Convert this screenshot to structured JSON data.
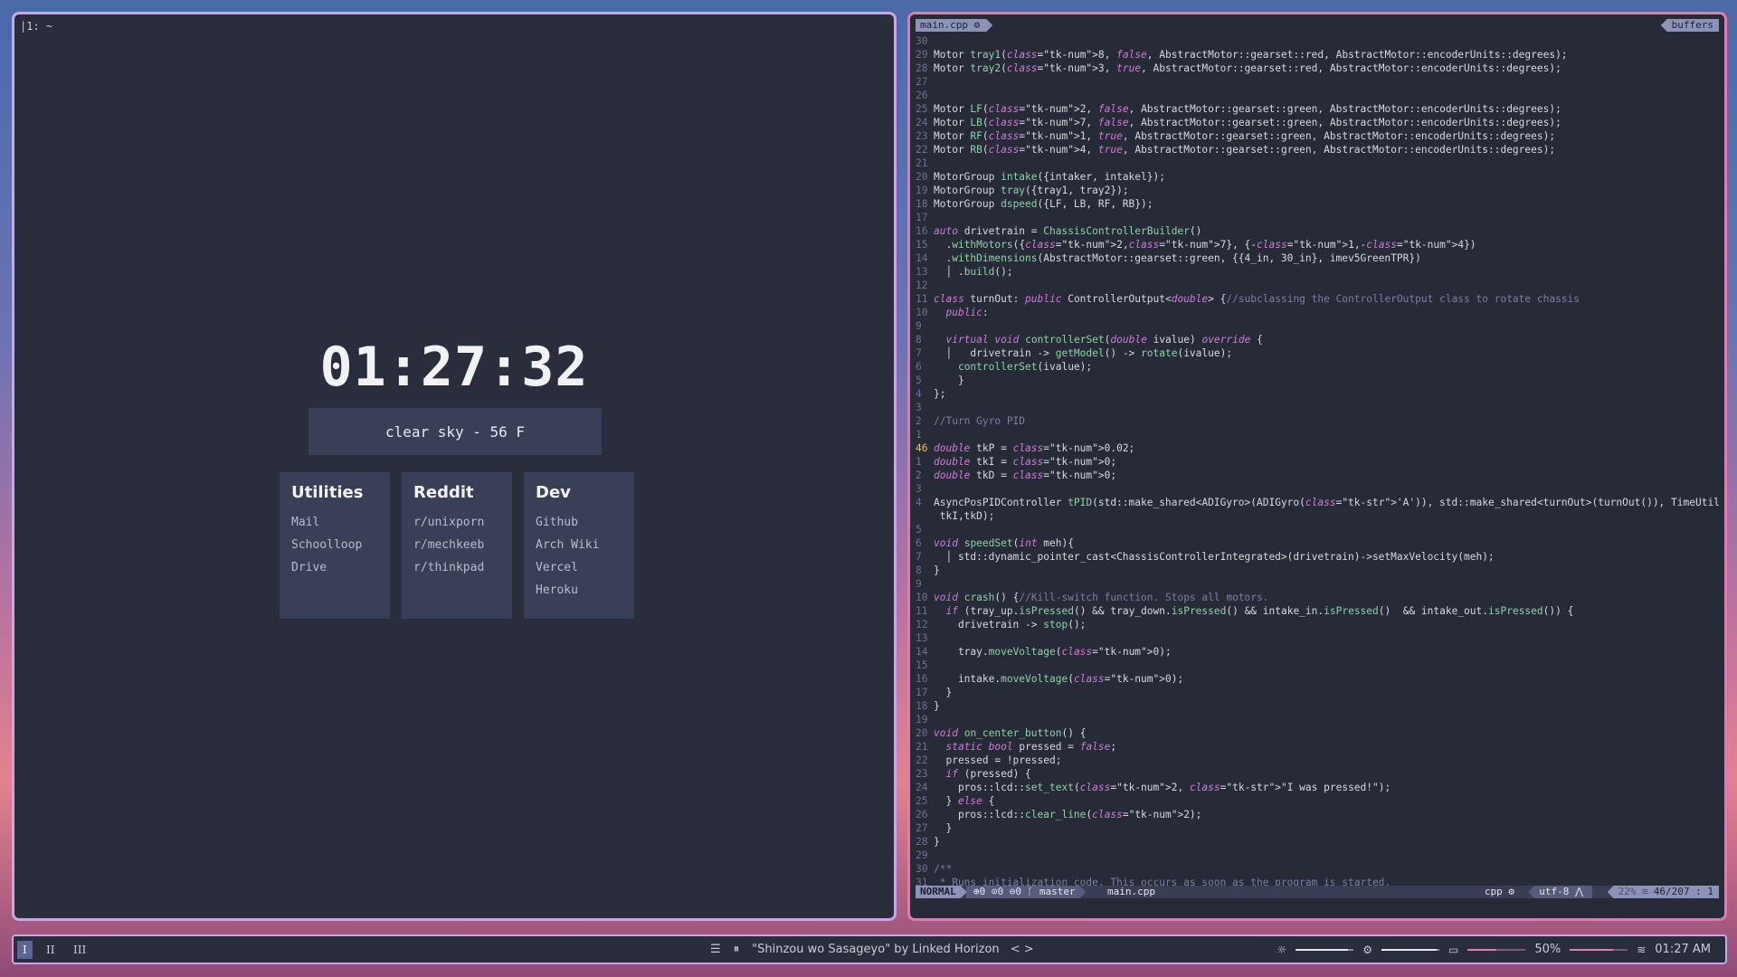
{
  "terminal": {
    "prompt": "|1: ~"
  },
  "startpage": {
    "clock": "01:27:32",
    "weather": "clear sky - 56 F",
    "cards": [
      {
        "title": "Utilities",
        "links": [
          "Mail",
          "Schoolloop",
          "Drive"
        ]
      },
      {
        "title": "Reddit",
        "links": [
          "r/unixporn",
          "r/mechkeeb",
          "r/thinkpad"
        ]
      },
      {
        "title": "Dev",
        "links": [
          "Github",
          "Arch Wiki",
          "Vercel",
          "Heroku"
        ]
      }
    ]
  },
  "editor": {
    "tab_file": "main.cpp ⚙",
    "tab_buffers": "buffers",
    "lines": [
      {
        "n": "30",
        "t": ""
      },
      {
        "n": "29",
        "t": "Motor tray1(8, false, AbstractMotor::gearset::red, AbstractMotor::encoderUnits::degrees);"
      },
      {
        "n": "28",
        "t": "Motor tray2(3, true, AbstractMotor::gearset::red, AbstractMotor::encoderUnits::degrees);"
      },
      {
        "n": "27",
        "t": ""
      },
      {
        "n": "26",
        "t": ""
      },
      {
        "n": "25",
        "t": "Motor LF(2, false, AbstractMotor::gearset::green, AbstractMotor::encoderUnits::degrees);"
      },
      {
        "n": "24",
        "t": "Motor LB(7, false, AbstractMotor::gearset::green, AbstractMotor::encoderUnits::degrees);"
      },
      {
        "n": "23",
        "t": "Motor RF(1, true, AbstractMotor::gearset::green, AbstractMotor::encoderUnits::degrees);"
      },
      {
        "n": "22",
        "t": "Motor RB(4, true, AbstractMotor::gearset::green, AbstractMotor::encoderUnits::degrees);"
      },
      {
        "n": "21",
        "t": ""
      },
      {
        "n": "20",
        "t": "MotorGroup intake({intaker, intakel});"
      },
      {
        "n": "19",
        "t": "MotorGroup tray({tray1, tray2});"
      },
      {
        "n": "18",
        "t": "MotorGroup dspeed({LF, LB, RF, RB});"
      },
      {
        "n": "17",
        "t": ""
      },
      {
        "n": "16",
        "t": "auto drivetrain = ChassisControllerBuilder()"
      },
      {
        "n": "15",
        "t": "  .withMotors({2,7}, {-1,-4})"
      },
      {
        "n": "14",
        "t": "  .withDimensions(AbstractMotor::gearset::green, {{4_in, 30_in}, imev5GreenTPR})"
      },
      {
        "n": "13",
        "t": "  │ .build();"
      },
      {
        "n": "12",
        "t": ""
      },
      {
        "n": "11",
        "t": "class turnOut: public ControllerOutput<double> {//subclassing the ControllerOutput class to rotate chassis"
      },
      {
        "n": "10",
        "t": "  public:"
      },
      {
        "n": "9",
        "t": ""
      },
      {
        "n": "8",
        "t": "  virtual void controllerSet(double ivalue) override {"
      },
      {
        "n": "7",
        "t": "  │   drivetrain -> getModel() -> rotate(ivalue);"
      },
      {
        "n": "6",
        "t": "    controllerSet(ivalue);"
      },
      {
        "n": "5",
        "t": "    }"
      },
      {
        "n": "4",
        "t": "};"
      },
      {
        "n": "3",
        "t": ""
      },
      {
        "n": "2",
        "t": "//Turn Gyro PID"
      },
      {
        "n": "1",
        "t": ""
      },
      {
        "n": "46",
        "t": "double tkP = 0.02;",
        "cur": true
      },
      {
        "n": "1",
        "t": "double tkI = 0;"
      },
      {
        "n": "2",
        "t": "double tkD = 0;"
      },
      {
        "n": "3",
        "t": ""
      },
      {
        "n": "4",
        "t": "AsyncPosPIDController tPID(std::make_shared<ADIGyro>(ADIGyro('A')), std::make_shared<turnOut>(turnOut()), TimeUtilFactory::createDefault(), tkP,"
      },
      {
        "n": "",
        "t": " tkI,tkD);"
      },
      {
        "n": "5",
        "t": ""
      },
      {
        "n": "6",
        "t": "void speedSet(int meh){"
      },
      {
        "n": "7",
        "t": "  │ std::dynamic_pointer_cast<ChassisControllerIntegrated>(drivetrain)->setMaxVelocity(meh);"
      },
      {
        "n": "8",
        "t": "}"
      },
      {
        "n": "9",
        "t": ""
      },
      {
        "n": "10",
        "t": "void crash() {//Kill-switch function. Stops all motors."
      },
      {
        "n": "11",
        "t": "  if (tray_up.isPressed() && tray_down.isPressed() && intake_in.isPressed()  && intake_out.isPressed()) {"
      },
      {
        "n": "12",
        "t": "    drivetrain -> stop();"
      },
      {
        "n": "13",
        "t": ""
      },
      {
        "n": "14",
        "t": "    tray.moveVoltage(0);"
      },
      {
        "n": "15",
        "t": ""
      },
      {
        "n": "16",
        "t": "    intake.moveVoltage(0);"
      },
      {
        "n": "17",
        "t": "  }"
      },
      {
        "n": "18",
        "t": "}"
      },
      {
        "n": "19",
        "t": ""
      },
      {
        "n": "20",
        "t": "void on_center_button() {"
      },
      {
        "n": "21",
        "t": "  static bool pressed = false;"
      },
      {
        "n": "22",
        "t": "  pressed = !pressed;"
      },
      {
        "n": "23",
        "t": "  if (pressed) {"
      },
      {
        "n": "24",
        "t": "    pros::lcd::set_text(2, \"I was pressed!\");"
      },
      {
        "n": "25",
        "t": "  } else {"
      },
      {
        "n": "26",
        "t": "    pros::lcd::clear_line(2);"
      },
      {
        "n": "27",
        "t": "  }"
      },
      {
        "n": "28",
        "t": "}"
      },
      {
        "n": "29",
        "t": ""
      },
      {
        "n": "30",
        "t": "/**"
      },
      {
        "n": "31",
        "t": " * Runs initialization code. This occurs as soon as the program is started."
      }
    ],
    "status": {
      "mode": "NORMAL",
      "git": "⊕0 ⊙0 ⊖0 ᚴ master",
      "file": "main.cpp",
      "filetype": "cpp ⚙",
      "encoding": "utf-8 ⋀",
      "percent": "22% ≡",
      "position": "46/207 :  1"
    }
  },
  "bar": {
    "workspaces": [
      "I",
      "II",
      "III"
    ],
    "active_workspace": 0,
    "now_playing": "\"Shinzou wo Sasageyo\" by Linked Horizon",
    "nav": "< >",
    "brightness_level": 0.9,
    "volume_level": 0.95,
    "battery_level": 0.5,
    "battery_text": "50%",
    "wifi_level": 0.75,
    "time": "01:27 AM",
    "icons": {
      "list": "list-icon",
      "pause": "pause-icon",
      "brightness": "brightness-icon",
      "settings": "gear-icon",
      "battery": "battery-icon",
      "wifi": "wifi-icon"
    }
  }
}
